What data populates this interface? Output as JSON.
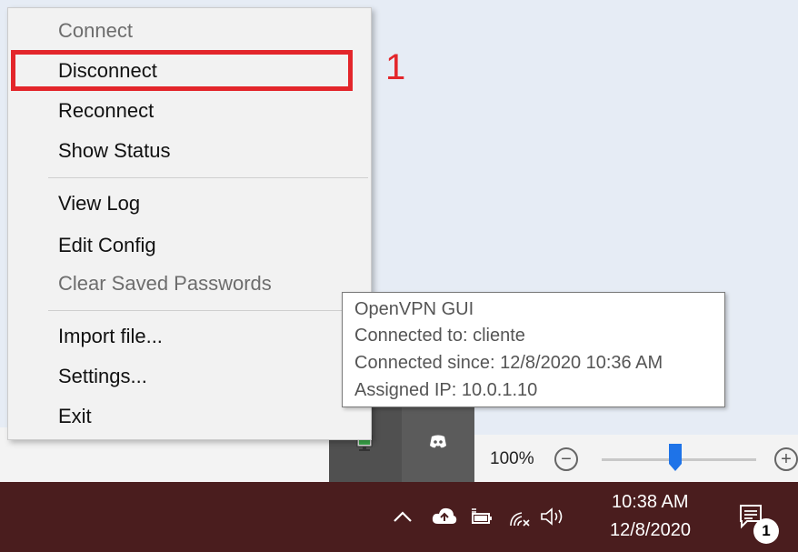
{
  "menu": {
    "items": [
      {
        "label": "Connect",
        "disabled": true
      },
      {
        "label": "Disconnect",
        "disabled": false
      },
      {
        "label": "Reconnect",
        "disabled": false
      },
      {
        "label": "Show Status",
        "disabled": false
      },
      {
        "label": "View Log",
        "disabled": false
      },
      {
        "label": "Edit Config",
        "disabled": false
      },
      {
        "label": "Clear Saved Passwords",
        "disabled": true
      },
      {
        "label": "Import file...",
        "disabled": false
      },
      {
        "label": "Settings...",
        "disabled": false
      },
      {
        "label": "Exit",
        "disabled": false
      }
    ]
  },
  "annotation": {
    "number": "1",
    "color": "#e3262b"
  },
  "tooltip": {
    "lines": [
      "OpenVPN GUI",
      "Connected to: cliente",
      "Connected since: 12/8/2020 10:36 AM",
      "Assigned IP: 10.0.1.10"
    ]
  },
  "tray_overflow": {
    "icons": [
      "openvpn-connected-icon",
      "discord-icon"
    ]
  },
  "zoom": {
    "percent": "100%",
    "minus": "−",
    "plus": "+"
  },
  "taskbar": {
    "color": "#4a1d1e",
    "tray_icons": [
      "chevron-up-icon",
      "cloud-upload-icon",
      "battery-icon",
      "wifi-icon",
      "volume-icon"
    ],
    "time": "10:38 AM",
    "date": "12/8/2020",
    "notification_count": "1"
  }
}
